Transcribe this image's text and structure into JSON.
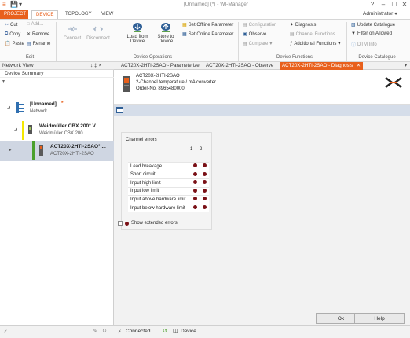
{
  "window": {
    "title": "[Unnamed] (*) - WI-Manager",
    "user": "Administrator"
  },
  "ribbon_tabs": [
    "PROJECT",
    "DEVICE",
    "TOPOLOGY",
    "VIEW"
  ],
  "ribbon": {
    "edit": {
      "cut": "Cut",
      "copy": "Copy",
      "paste": "Paste",
      "add": "Add...",
      "remove": "Remove",
      "rename": "Rename",
      "group": "Edit"
    },
    "device_ops": {
      "connect": "Connect",
      "disconnect": "Disconnect",
      "load_line1": "Load from",
      "load_line2": "Device",
      "store_line1": "Store to",
      "store_line2": "Device",
      "group": "Device Operations"
    },
    "params": {
      "set_offline": "Set Offline Parameter",
      "set_online": "Set Online Parameter"
    },
    "device_functions": {
      "configuration": "Configuration",
      "observe": "Observe",
      "compare": "Compare",
      "diagnosis": "Diagnosis",
      "channel_functions": "Channel Functions",
      "additional_functions": "Additional Functions",
      "group": "Device Functions"
    },
    "catalogue": {
      "update": "Update Catalogue",
      "filter": "Filter on Allowed",
      "dtm_info": "DTM Info",
      "group": "Device Catalogue"
    }
  },
  "network_view": {
    "title": "Network View",
    "pin": "↓ ‡ ×",
    "device_summary": "Device Summary",
    "tree": [
      {
        "name": "[Unnamed]",
        "marker": "*",
        "sub": "Network"
      },
      {
        "name": "Weidmüller CBX 200° V...",
        "sub": "Weidmüller CBX 200"
      },
      {
        "name": "ACT20X-2HTI-2SAO° ...",
        "sub": "ACT20X-2HTI-2SAO"
      }
    ]
  },
  "doc_tabs": [
    {
      "label": "ACT20X-2HTI-2SAO - Parameterize",
      "active": false
    },
    {
      "label": "ACT20X-2HTI-2SAO - Observe",
      "active": false
    },
    {
      "label": "ACT20X-2HTI-2SAO - Diagnosis",
      "active": true
    }
  ],
  "device_header": {
    "name": "ACT20X-2HTI-2SAO",
    "desc": "2-Channel temperature / mA converter",
    "order": "Order-No. 8965480000"
  },
  "channel_errors": {
    "title": "Channel errors",
    "columns": [
      "1",
      "2"
    ],
    "rows": [
      "Lead breakage",
      "Short circuit",
      "Input high limit",
      "Input low limit",
      "Input above hardware limit",
      "Input below hardware limit"
    ]
  },
  "show_extended_errors": "Show extended errors",
  "buttons": {
    "ok": "Ok",
    "help": "Help"
  },
  "status": {
    "connected": "Connected",
    "device": "Device"
  },
  "colors": {
    "accent": "#e8601c",
    "led": "#7a1016",
    "band": "#d5dde9"
  }
}
